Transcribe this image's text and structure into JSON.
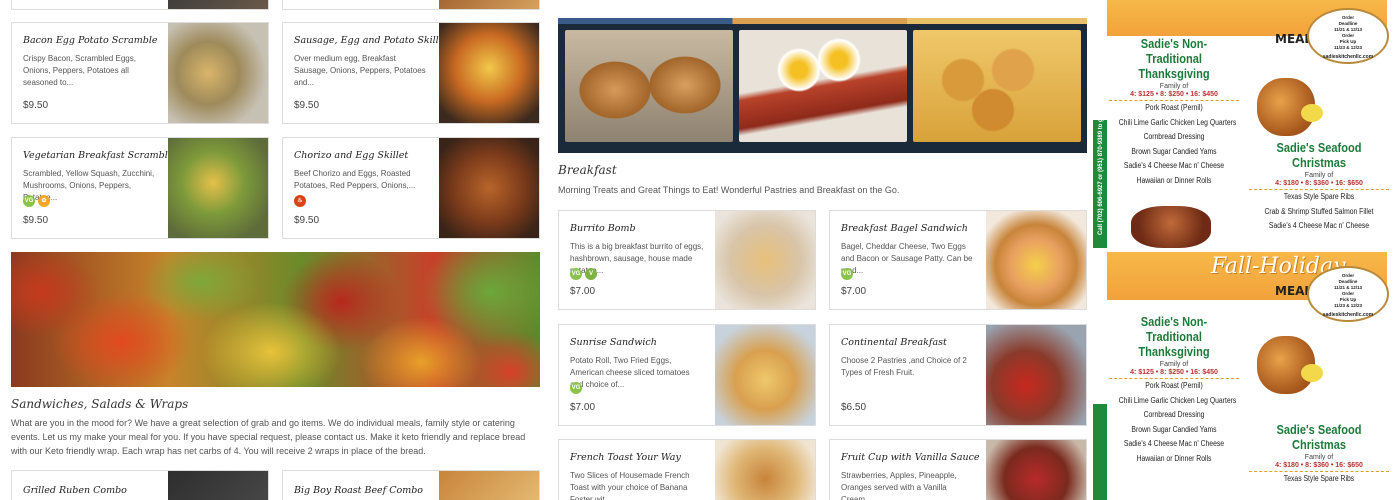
{
  "colors": {
    "price_text": "#444444",
    "badge_vg": "#8bc34a",
    "badge_v": "#7cb342",
    "badge_gf": "#f4a62a",
    "badge_spicy": "#d84315",
    "flyer_green": "#1e8b3c",
    "flyer_orange": "#f2a23a"
  },
  "left_menu": {
    "cards": [
      {
        "title": "Bacon Egg Potato Scramble",
        "desc": "Crispy Bacon, Scrambled Eggs, Onions, Peppers, Potatoes all seasoned to...",
        "price": "$9.50",
        "badges": []
      },
      {
        "title": "Sausage, Egg and Potato Skillet",
        "desc": "Over medium egg, Breakfast Sausage, Onions, Peppers, Potatoes and...",
        "price": "$9.50",
        "badges": []
      },
      {
        "title": "Vegetarian Breakfast Scramble",
        "desc": "Scrambled, Yellow Squash, Zucchini, Mushrooms, Onions, Peppers, Potatoe...",
        "price": "$9.50",
        "badges": [
          "vg-badge-icon",
          "gf-badge-icon"
        ]
      },
      {
        "title": "Chorizo and Egg Skillet",
        "desc": "Beef Chorizo and Eggs, Roasted Potatoes, Red Peppers, Onions,...",
        "price": "$9.50",
        "badges": [
          "spicy-badge-icon"
        ]
      }
    ],
    "sandwiches": {
      "title": "Sandwiches, Salads & Wraps",
      "description": "What are you in the mood for? We have a great selection of grab and go items. We do individual meals, family style or catering events. Let us my make your meal for you. If you have special request, please contact us. Make it keto friendly and replace bread with our Keto friendly wrap. Each wrap has net carbs of 4. You will receive 2 wraps in place of the bread.",
      "cards": [
        {
          "title": "Grilled Ruben Combo"
        },
        {
          "title": "Big Boy Roast Beef Combo"
        }
      ]
    }
  },
  "breakfast": {
    "title": "Breakfast",
    "description": "Morning Treats and Great Things to Eat! Wonderful Pastries and Breakfast on the Go.",
    "cards": [
      {
        "title": "Burrito Bomb",
        "desc": "This is a big breakfast burrito of eggs, hashbrown, sausage, house made potatoe...",
        "price": "$7.00",
        "badges": [
          "VG",
          "V"
        ]
      },
      {
        "title": "Breakfast Bagel Sandwich",
        "desc": "Bagel, Cheddar Cheese, Two Eggs and Bacon or Sausage Patty. Can be mad...",
        "price": "$7.00",
        "badges": [
          "VG"
        ]
      },
      {
        "title": "Sunrise Sandwich",
        "desc": "Potato Roll, Two Fried Eggs, American cheese sliced tomatoes and choice of...",
        "price": "$7.00",
        "badges": [
          "VG"
        ]
      },
      {
        "title": "Continental Breakfast",
        "desc": "Choose 2 Pastries ,and Choice of 2 Types of Fresh Fruit.",
        "price": "$6.50",
        "badges": []
      },
      {
        "title": "French Toast Your Way",
        "desc": "Two Slices of Housemade French Toast with your choice of Banana Foster wit...",
        "price": "",
        "badges": []
      },
      {
        "title": "Fruit Cup with Vanilla Sauce",
        "desc": "Strawberries, Apples, Pineapple, Oranges served with a Vanilla Cream...",
        "price": "",
        "badges": []
      }
    ]
  },
  "flyer": {
    "fall_title": "Fall-Holiday",
    "meal_deals": "MEAL DEALS",
    "deadline_lines": [
      "Order",
      "Deadline",
      "11/21 & 12/13",
      "Order",
      "Pick Up",
      "11/23 & 12/23"
    ],
    "site": "sadieskitchenllc.com",
    "side_text": "Call (702) 606-6927 or (951) 870-9389 to get pricing and plan an event",
    "thanksgiving": {
      "title_line1": "Sadie's Non-Traditional",
      "title_line2": "Thanksgiving",
      "family": "Family of",
      "prices": "4: $125 • 8: $250 • 16: $450",
      "items": [
        "Pork Roast (Pernil)",
        "Chili Lime Garlic Chicken Leg Quarters",
        "Cornbread Dressing",
        "Brown Sugar Candied Yams",
        "Sadie's 4 Cheese Mac n' Cheese",
        "Hawaiian or Dinner Rolls"
      ]
    },
    "christmas": {
      "title_line1": "Sadie's Seafood",
      "title_line2": "Christmas",
      "family": "Family of",
      "prices": "4: $180 • 8: $360 • 16: $650",
      "items": [
        "Texas Style Spare Ribs",
        "Crab & Shrimp Stuffed Salmon Fillet",
        "Sadie's 4 Cheese Mac n' Cheese"
      ]
    }
  }
}
